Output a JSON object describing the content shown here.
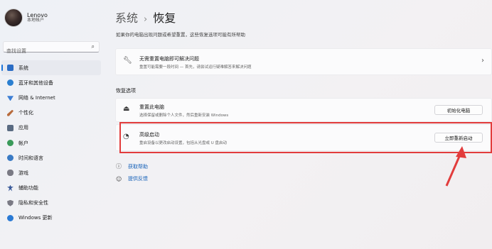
{
  "profile": {
    "name": "Lenovo",
    "account": "本地帐户"
  },
  "search": {
    "placeholder": "查找设置"
  },
  "sidebar": {
    "items": [
      {
        "label": "系统",
        "color": "#2b6cc4"
      },
      {
        "label": "蓝牙和其他设备",
        "color": "#2b7fd0"
      },
      {
        "label": "网络 & Internet",
        "color": "#3c7ed4"
      },
      {
        "label": "个性化",
        "color": "#b86b3c"
      },
      {
        "label": "应用",
        "color": "#5a6b82"
      },
      {
        "label": "帐户",
        "color": "#3a9a5a"
      },
      {
        "label": "时间和语言",
        "color": "#3a7ac4"
      },
      {
        "label": "游戏",
        "color": "#7a7a84"
      },
      {
        "label": "辅助功能",
        "color": "#3a5a9a"
      },
      {
        "label": "隐私和安全性",
        "color": "#7a7a84"
      },
      {
        "label": "Windows 更新",
        "color": "#2a7ad4"
      }
    ]
  },
  "header": {
    "parent": "系统",
    "separator": "›",
    "title": "恢复"
  },
  "subtitle": "如果你的电脑出现问题或希望重置，这些恢复选项可能有所帮助",
  "troubleshoot": {
    "title": "无需重置电脑即可解决问题",
    "desc": "重置可能需要一段时间 — 首先，请尝试运行疑难解答来解决问题"
  },
  "section_label": "恢复选项",
  "reset": {
    "title": "重置此电脑",
    "desc": "选择保留或删除个人文件，然后重新安装 Windows",
    "button": "初始化电脑"
  },
  "advanced": {
    "title": "高级启动",
    "desc": "重启设备以更改启动设置，包括从光盘或 U 盘启动",
    "button": "立即重新启动"
  },
  "links": {
    "help": "获取帮助",
    "feedback": "提供反馈"
  },
  "annotation_color": "#e23c3c"
}
